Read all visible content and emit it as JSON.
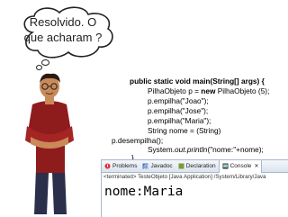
{
  "bubble": {
    "text": "Resolvido. O que acharam ?"
  },
  "code": {
    "signature": "public static void main(String[] args) {",
    "line1_pre": "PilhaObjeto p = ",
    "line1_bold": "new",
    "line1_post": " PilhaObjeto (5);",
    "line2": "p.empilha(\"Joao\");",
    "line3": "p.empilha(\"Jose\");",
    "line4": "p.empilha(\"Maria\");",
    "line5": "String nome = (String)",
    "line6": "p.desempilha();",
    "line7_pre": "System.",
    "line7_out": "out",
    "line7_mid": ".",
    "line7_println": "println",
    "line7_post": "(\"nome:\"+nome);",
    "closing": "}"
  },
  "console": {
    "tabs": [
      {
        "label": "Problems",
        "icon": "problems-icon"
      },
      {
        "label": "Javadoc",
        "icon": "javadoc-icon"
      },
      {
        "label": "Declaration",
        "icon": "declaration-icon"
      },
      {
        "label": "Console",
        "icon": "console-icon",
        "active": true
      }
    ],
    "close_glyph": "✕",
    "status": "<terminated> TesteObjeto [Java Application] /System/Library/Java",
    "output": "nome:Maria"
  }
}
